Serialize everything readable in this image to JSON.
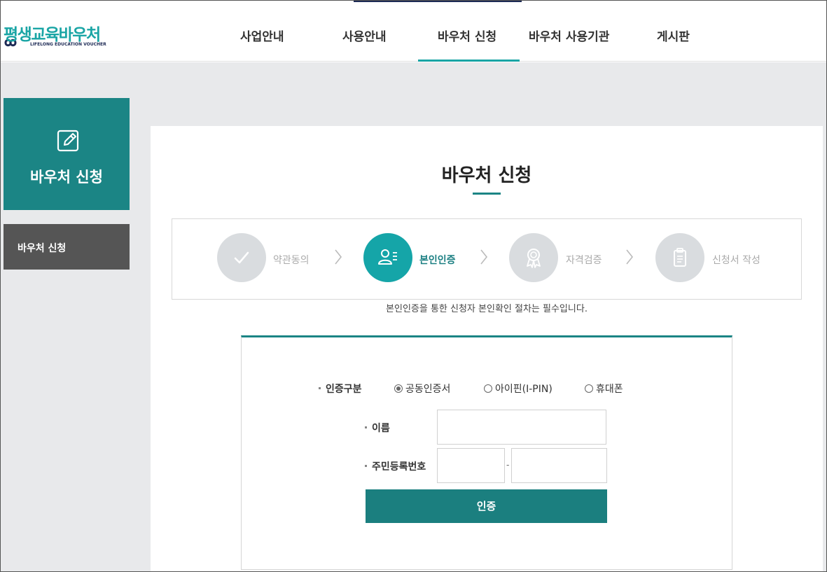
{
  "header": {
    "logo_text": "평생교육바우처",
    "logo_sub": "LIFELONG EDUCATION VOUCHER",
    "nav": [
      "사업안내",
      "사용안내",
      "바우처 신청",
      "바우처 사용기관",
      "게시판"
    ]
  },
  "sidebar": {
    "title": "바우처 신청",
    "menu_item": "바우처 신청"
  },
  "main": {
    "title": "바우처 신청",
    "steps": [
      {
        "label": "약관동의",
        "icon": "check-icon",
        "active": false
      },
      {
        "label": "본인인증",
        "icon": "user-id-icon",
        "active": true
      },
      {
        "label": "자격검증",
        "icon": "award-icon",
        "active": false
      },
      {
        "label": "신청서 작성",
        "icon": "clipboard-icon",
        "active": false
      }
    ],
    "notice": "본인인증을 통한 신청자 본인확인 절차는 필수입니다."
  },
  "form": {
    "auth_type_label": "인증구분",
    "auth_options": [
      "공동인증서",
      "아이핀(I-PIN)",
      "휴대폰"
    ],
    "selected_option": "공동인증서",
    "name_label": "이름",
    "name_value": "",
    "rrn_label": "주민등록번호",
    "rrn_front": "",
    "rrn_back": "",
    "rrn_separator": "-",
    "submit_label": "인증"
  },
  "colors": {
    "primary": "#1b8585",
    "accent": "#15a5a8",
    "sidebar_menu": "#555555",
    "background": "#e8e9eb"
  }
}
